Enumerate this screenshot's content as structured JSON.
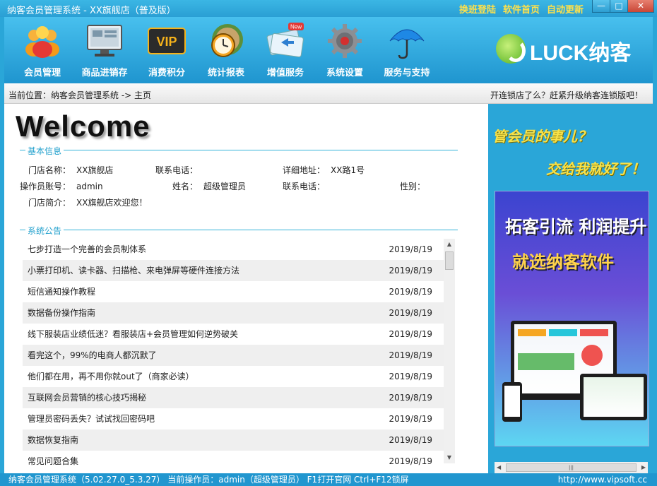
{
  "window": {
    "title": "纳客会员管理系统 - XX旗舰店（普及版）",
    "links": [
      "换班登陆",
      "软件首页",
      "自动更新"
    ],
    "controls": {
      "minimize": "—",
      "maximize": "□",
      "close": "✕"
    }
  },
  "toolbar": {
    "items": [
      {
        "label": "会员管理",
        "icon": "members-icon"
      },
      {
        "label": "商品进销存",
        "icon": "monitor-icon"
      },
      {
        "label": "消费积分",
        "icon": "vip-icon"
      },
      {
        "label": "统计报表",
        "icon": "report-clock-icon"
      },
      {
        "label": "增值服务",
        "icon": "value-added-icon"
      },
      {
        "label": "系统设置",
        "icon": "gear-icon"
      },
      {
        "label": "服务与支持",
        "icon": "umbrella-icon"
      }
    ],
    "new_badge": "New",
    "logo_text": "LUCK纳客"
  },
  "breadcrumb": {
    "text": "当前位置：纳客会员管理系统 -> 主页",
    "promo": "开连锁店了么？赶紧升级纳客连锁版吧！"
  },
  "welcome": "Welcome",
  "basic_info": {
    "section_title": "基本信息",
    "store_name_label": "门店名称：",
    "store_name": "XX旗舰店",
    "phone_label": "联系电话：",
    "phone": "",
    "address_label": "详细地址：",
    "address": "XX路1号",
    "operator_label": "操作员账号：",
    "operator": "admin",
    "name_label": "姓名：",
    "name": "超级管理员",
    "phone2_label": "联系电话：",
    "phone2": "",
    "gender_label": "性别：",
    "gender": "",
    "intro_label": "门店简介：",
    "intro": "XX旗舰店欢迎您！"
  },
  "notices": {
    "section_title": "系统公告",
    "items": [
      {
        "title": "七步打造一个完善的会员制体系",
        "date": "2019/8/19"
      },
      {
        "title": "小票打印机、读卡器、扫描枪、来电弹屏等硬件连接方法",
        "date": "2019/8/19"
      },
      {
        "title": "短信通知操作教程",
        "date": "2019/8/19"
      },
      {
        "title": "数据备份操作指南",
        "date": "2019/8/19"
      },
      {
        "title": "线下服装店业绩低迷？看服装店+会员管理如何逆势破关",
        "date": "2019/8/19"
      },
      {
        "title": "看完这个，99%的电商人都沉默了",
        "date": "2019/8/19"
      },
      {
        "title": "他们都在用，再不用你就out了（商家必读）",
        "date": "2019/8/19"
      },
      {
        "title": "互联网会员营销的核心技巧揭秘",
        "date": "2019/8/19"
      },
      {
        "title": "管理员密码丢失？试试找回密码吧",
        "date": "2019/8/19"
      },
      {
        "title": "数据恢复指南",
        "date": "2019/8/19"
      },
      {
        "title": "常见问题合集",
        "date": "2019/8/19"
      }
    ]
  },
  "side": {
    "slogan1": "管会员的事儿？",
    "slogan2": "交给我就好了！",
    "ad_line1": "拓客引流 利润提升",
    "ad_line2": "就选纳客软件",
    "scroll_left": "◀",
    "scroll_right": "▶",
    "scroll_grip": "|||"
  },
  "status": {
    "left": "纳客会员管理系统（5.02.27.0_5.3.27） 当前操作员：admin（超级管理员） F1打开官网 Ctrl+F12锁屏",
    "right": "http://www.vipsoft.cc"
  },
  "colors": {
    "accent": "#2aa6d8",
    "section_line": "#33b3d8",
    "link_yellow": "#ffe14a"
  }
}
